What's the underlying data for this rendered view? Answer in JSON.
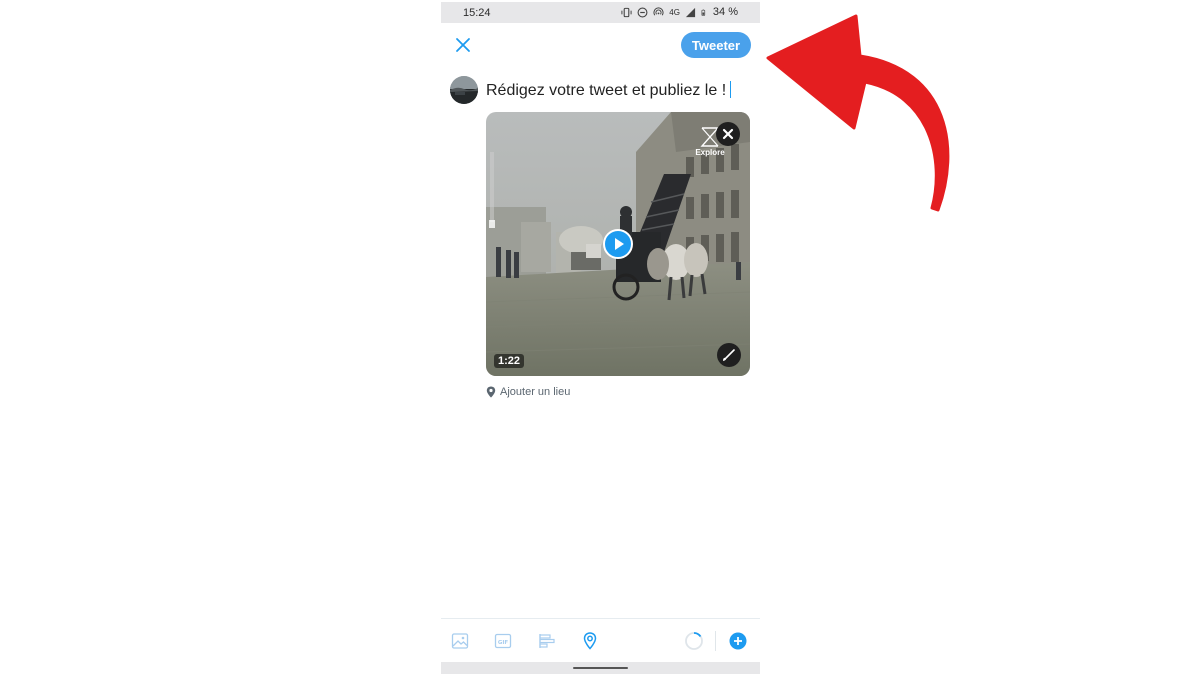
{
  "status_bar": {
    "time": "15:24",
    "network": "4G",
    "battery": "34 %"
  },
  "compose": {
    "tweet_button": "Tweeter",
    "placeholder_text": "Rédigez votre tweet et publiez le !",
    "close_icon": "close-icon"
  },
  "media": {
    "duration": "1:22",
    "watermark": "Explore",
    "icons": {
      "remove": "close-icon",
      "play": "play-icon",
      "edit": "paintbrush-icon"
    }
  },
  "location": {
    "label": "Ajouter un lieu",
    "icon": "location-pin-icon"
  },
  "toolbar": {
    "icons": [
      "image-icon",
      "gif-icon",
      "poll-icon",
      "location-icon",
      "character-counter-icon",
      "add-thread-icon"
    ]
  },
  "colors": {
    "accent": "#4aa1eb",
    "twitter_blue": "#1d9bf0",
    "annotation_arrow": "#e41e20"
  }
}
